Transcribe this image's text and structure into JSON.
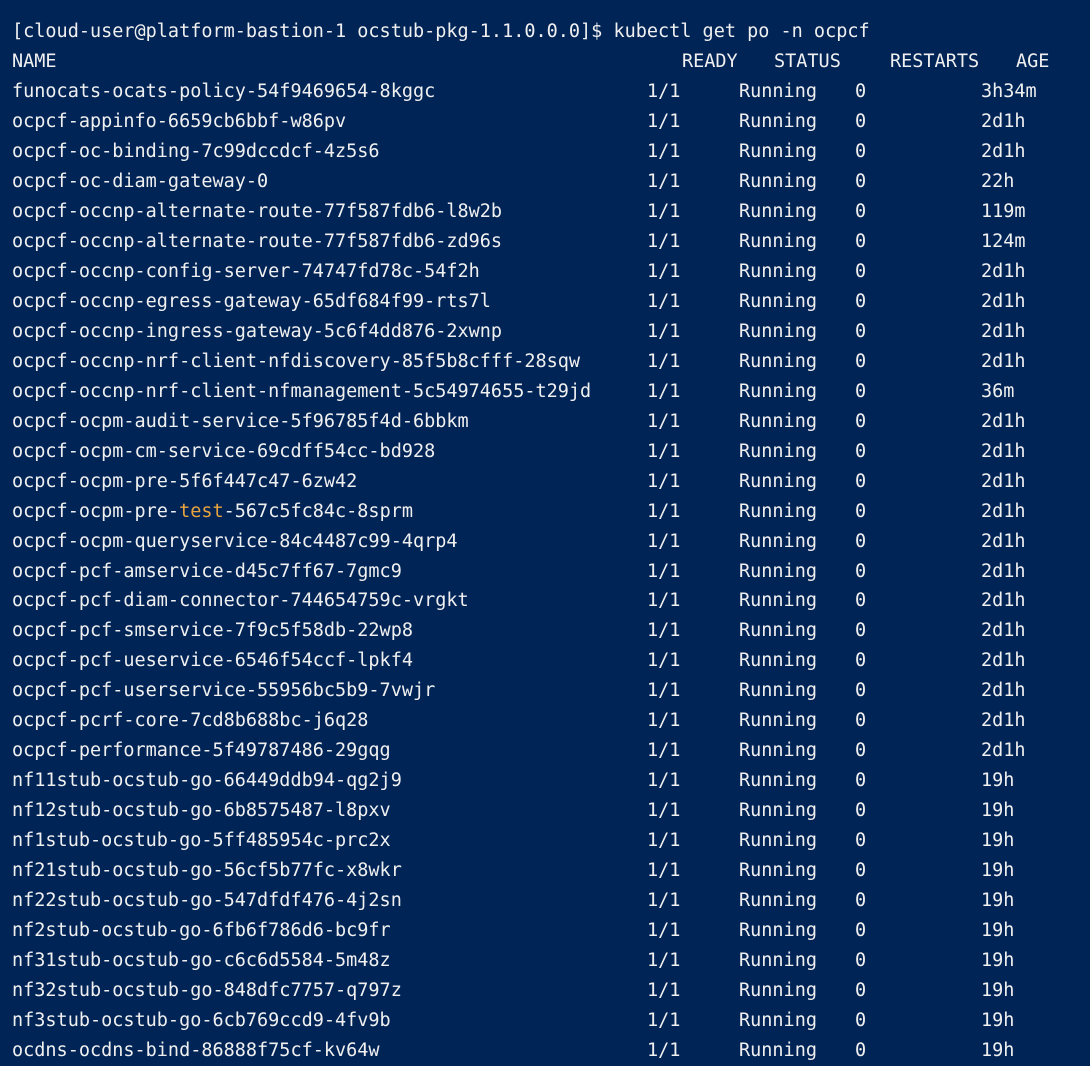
{
  "terminal": {
    "prompt": "[cloud-user@platform-bastion-1 ocstub-pkg-1.1.0.0.0]$ kubectl get po -n ocpcf",
    "headers": {
      "name": "NAME",
      "ready": "READY",
      "status": "STATUS",
      "restarts": "RESTARTS",
      "age": "AGE"
    },
    "highlight_color": "#e8a33d",
    "background_color": "#012456",
    "rows": [
      {
        "name": "funocats-ocats-policy-54f9469654-8kggc",
        "ready": "1/1",
        "status": "Running",
        "restarts": "0",
        "age": "3h34m"
      },
      {
        "name": "ocpcf-appinfo-6659cb6bbf-w86pv",
        "ready": "1/1",
        "status": "Running",
        "restarts": "0",
        "age": "2d1h"
      },
      {
        "name": "ocpcf-oc-binding-7c99dccdcf-4z5s6",
        "ready": "1/1",
        "status": "Running",
        "restarts": "0",
        "age": "2d1h"
      },
      {
        "name": "ocpcf-oc-diam-gateway-0",
        "ready": "1/1",
        "status": "Running",
        "restarts": "0",
        "age": "22h"
      },
      {
        "name": "ocpcf-occnp-alternate-route-77f587fdb6-l8w2b",
        "ready": "1/1",
        "status": "Running",
        "restarts": "0",
        "age": "119m"
      },
      {
        "name": "ocpcf-occnp-alternate-route-77f587fdb6-zd96s",
        "ready": "1/1",
        "status": "Running",
        "restarts": "0",
        "age": "124m"
      },
      {
        "name": "ocpcf-occnp-config-server-74747fd78c-54f2h",
        "ready": "1/1",
        "status": "Running",
        "restarts": "0",
        "age": "2d1h"
      },
      {
        "name": "ocpcf-occnp-egress-gateway-65df684f99-rts7l",
        "ready": "1/1",
        "status": "Running",
        "restarts": "0",
        "age": "2d1h"
      },
      {
        "name": "ocpcf-occnp-ingress-gateway-5c6f4dd876-2xwnp",
        "ready": "1/1",
        "status": "Running",
        "restarts": "0",
        "age": "2d1h"
      },
      {
        "name": "ocpcf-occnp-nrf-client-nfdiscovery-85f5b8cfff-28sqw",
        "ready": "1/1",
        "status": "Running",
        "restarts": "0",
        "age": "2d1h"
      },
      {
        "name": "ocpcf-occnp-nrf-client-nfmanagement-5c54974655-t29jd",
        "ready": "1/1",
        "status": "Running",
        "restarts": "0",
        "age": "36m"
      },
      {
        "name": "ocpcf-ocpm-audit-service-5f96785f4d-6bbkm",
        "ready": "1/1",
        "status": "Running",
        "restarts": "0",
        "age": "2d1h"
      },
      {
        "name": "ocpcf-ocpm-cm-service-69cdff54cc-bd928",
        "ready": "1/1",
        "status": "Running",
        "restarts": "0",
        "age": "2d1h"
      },
      {
        "name": "ocpcf-ocpm-pre-5f6f447c47-6zw42",
        "ready": "1/1",
        "status": "Running",
        "restarts": "0",
        "age": "2d1h"
      },
      {
        "name_pre": "ocpcf-ocpm-pre-",
        "name_hl": "test",
        "name_post": "-567c5fc84c-8sprm",
        "ready": "1/1",
        "status": "Running",
        "restarts": "0",
        "age": "2d1h"
      },
      {
        "name": "ocpcf-ocpm-queryservice-84c4487c99-4qrp4",
        "ready": "1/1",
        "status": "Running",
        "restarts": "0",
        "age": "2d1h"
      },
      {
        "name": "ocpcf-pcf-amservice-d45c7ff67-7gmc9",
        "ready": "1/1",
        "status": "Running",
        "restarts": "0",
        "age": "2d1h"
      },
      {
        "name": "ocpcf-pcf-diam-connector-744654759c-vrgkt",
        "ready": "1/1",
        "status": "Running",
        "restarts": "0",
        "age": "2d1h"
      },
      {
        "name": "ocpcf-pcf-smservice-7f9c5f58db-22wp8",
        "ready": "1/1",
        "status": "Running",
        "restarts": "0",
        "age": "2d1h"
      },
      {
        "name": "ocpcf-pcf-ueservice-6546f54ccf-lpkf4",
        "ready": "1/1",
        "status": "Running",
        "restarts": "0",
        "age": "2d1h"
      },
      {
        "name": "ocpcf-pcf-userservice-55956bc5b9-7vwjr",
        "ready": "1/1",
        "status": "Running",
        "restarts": "0",
        "age": "2d1h"
      },
      {
        "name": "ocpcf-pcrf-core-7cd8b688bc-j6q28",
        "ready": "1/1",
        "status": "Running",
        "restarts": "0",
        "age": "2d1h"
      },
      {
        "name": "ocpcf-performance-5f49787486-29gqg",
        "ready": "1/1",
        "status": "Running",
        "restarts": "0",
        "age": "2d1h"
      },
      {
        "name": "nf11stub-ocstub-go-66449ddb94-qg2j9",
        "ready": "1/1",
        "status": "Running",
        "restarts": "0",
        "age": "19h"
      },
      {
        "name": "nf12stub-ocstub-go-6b8575487-l8pxv",
        "ready": "1/1",
        "status": "Running",
        "restarts": "0",
        "age": "19h"
      },
      {
        "name": "nf1stub-ocstub-go-5ff485954c-prc2x",
        "ready": "1/1",
        "status": "Running",
        "restarts": "0",
        "age": "19h"
      },
      {
        "name": "nf21stub-ocstub-go-56cf5b77fc-x8wkr",
        "ready": "1/1",
        "status": "Running",
        "restarts": "0",
        "age": "19h"
      },
      {
        "name": "nf22stub-ocstub-go-547dfdf476-4j2sn",
        "ready": "1/1",
        "status": "Running",
        "restarts": "0",
        "age": "19h"
      },
      {
        "name": "nf2stub-ocstub-go-6fb6f786d6-bc9fr",
        "ready": "1/1",
        "status": "Running",
        "restarts": "0",
        "age": "19h"
      },
      {
        "name": "nf31stub-ocstub-go-c6c6d5584-5m48z",
        "ready": "1/1",
        "status": "Running",
        "restarts": "0",
        "age": "19h"
      },
      {
        "name": "nf32stub-ocstub-go-848dfc7757-q797z",
        "ready": "1/1",
        "status": "Running",
        "restarts": "0",
        "age": "19h"
      },
      {
        "name": "nf3stub-ocstub-go-6cb769ccd9-4fv9b",
        "ready": "1/1",
        "status": "Running",
        "restarts": "0",
        "age": "19h"
      },
      {
        "name": "ocdns-ocdns-bind-86888f75cf-kv64w",
        "ready": "1/1",
        "status": "Running",
        "restarts": "0",
        "age": "19h"
      }
    ]
  }
}
